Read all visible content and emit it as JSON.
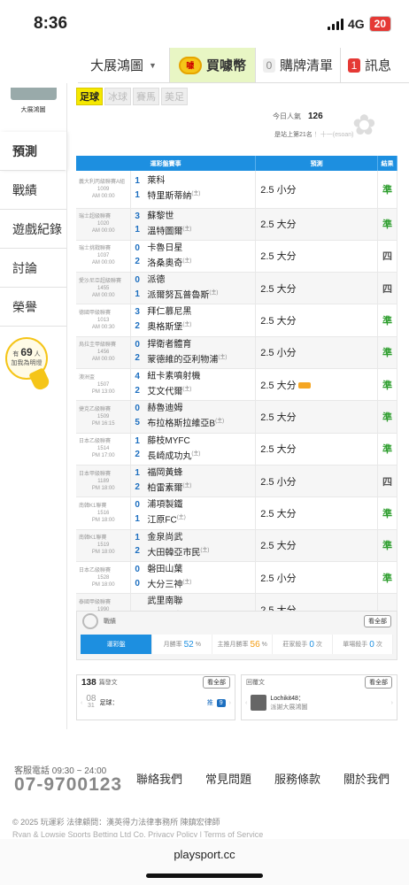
{
  "status": {
    "time": "8:36",
    "network": "4G",
    "battery": "20"
  },
  "nav": {
    "dropdown": "大展鴻圖",
    "coin_label": "買噱幣",
    "coin_icon_text": "噱",
    "cart_count": "0",
    "cart_label": "購牌清單",
    "msg_count": "1",
    "msg_label": "訊息"
  },
  "sidebar": {
    "avatar_label": "大展鴻圖",
    "items": [
      "預測",
      "戰績",
      "遊戲紀錄",
      "討論",
      "榮譽"
    ]
  },
  "online": {
    "prefix": "有",
    "count": "69",
    "suffix": "人",
    "line2": "加我為明燈"
  },
  "sport_tabs": [
    "足球",
    "冰球",
    "賽馬",
    "美足"
  ],
  "stats": {
    "pop_label": "今日人氣",
    "pop_value": "126",
    "rank_text": "是站上第21名",
    "rank_extra": "！十一(esoan)"
  },
  "table": {
    "headers": [
      "運彩盤賽事",
      "預測",
      "結果"
    ],
    "rows": [
      {
        "league": "義大利丙級聯賽A組",
        "no": "1009",
        "time": "AM 00:00",
        "s1": "1",
        "t1": "萊科",
        "s2": "1",
        "t2": "特里斯蒂納",
        "m2": "(主)",
        "pred": "2.5 小分",
        "res": "準",
        "rt": "win"
      },
      {
        "league": "瑞士超級聯賽",
        "no": "1020",
        "time": "AM 00:00",
        "s1": "3",
        "t1": "蘇黎世",
        "s2": "1",
        "t2": "溫特圖爾",
        "m2": "(主)",
        "pred": "2.5 大分",
        "res": "準",
        "rt": "win"
      },
      {
        "league": "瑞士挑戰聯賽",
        "no": "1037",
        "time": "AM 00:00",
        "s1": "0",
        "t1": "卡魯日星",
        "s2": "2",
        "t2": "洛桑奧奇",
        "m2": "(主)",
        "pred": "2.5 大分",
        "res": "四",
        "rt": "lose"
      },
      {
        "league": "愛沙尼亞超級聯賽",
        "no": "1455",
        "time": "AM 00:00",
        "s1": "0",
        "t1": "派德",
        "s2": "1",
        "t2": "派爾努瓦普魯斯",
        "m2": "(主)",
        "pred": "2.5 大分",
        "res": "四",
        "rt": "lose"
      },
      {
        "league": "德國甲級聯賽",
        "no": "1013",
        "time": "AM 00:30",
        "s1": "3",
        "t1": "拜仁慕尼黑",
        "s2": "2",
        "t2": "奧格斯堡",
        "m2": "(主)",
        "pred": "2.5 大分",
        "res": "準",
        "rt": "win"
      },
      {
        "league": "烏拉圭甲級聯賽",
        "no": "1456",
        "time": "AM 00:00",
        "s1": "0",
        "t1": "捍衛者體育",
        "s2": "2",
        "t2": "蒙德維的亞利物浦",
        "m2": "(主)",
        "pred": "2.5 小分",
        "res": "準",
        "rt": "win"
      },
      {
        "league": "澳洲盃",
        "no": "1507",
        "time": "PM 13:00",
        "s1": "4",
        "t1": "紐卡素噴射機",
        "s2": "2",
        "t2": "艾文代爾",
        "m2": "(主)",
        "pred": "2.5 大分",
        "hot": true,
        "res": "準",
        "rt": "win"
      },
      {
        "league": "捷克乙級聯賽",
        "no": "1509",
        "time": "PM 16:15",
        "s1": "0",
        "t1": "赫魯迪姆",
        "s2": "5",
        "t2": "布拉格斯拉維亞B",
        "m2": "(主)",
        "pred": "2.5 大分",
        "res": "準",
        "rt": "win"
      },
      {
        "league": "日本乙級聯賽",
        "no": "1514",
        "time": "PM 17:00",
        "s1": "1",
        "t1": "藤枝MYFC",
        "s2": "2",
        "t2": "長崎成功丸",
        "m2": "(主)",
        "pred": "2.5 大分",
        "res": "準",
        "rt": "win"
      },
      {
        "league": "日本甲級聯賽",
        "no": "1189",
        "time": "PM 18:00",
        "s1": "1",
        "t1": "福岡黃蜂",
        "s2": "2",
        "t2": "柏雷素爾",
        "m2": "(主)",
        "pred": "2.5 小分",
        "res": "四",
        "rt": "lose"
      },
      {
        "league": "南韓K1聯賽",
        "no": "1516",
        "time": "PM 18:00",
        "s1": "0",
        "t1": "浦項製鐵",
        "s2": "1",
        "t2": "江原FC",
        "m2": "(主)",
        "pred": "2.5 大分",
        "res": "準",
        "rt": "win"
      },
      {
        "league": "南韓K1聯賽",
        "no": "1519",
        "time": "PM 18:00",
        "s1": "1",
        "t1": "金泉尚武",
        "s2": "2",
        "t2": "大田韓亞市民",
        "m2": "(主)",
        "pred": "2.5 大分",
        "res": "準",
        "rt": "win"
      },
      {
        "league": "日本乙級聯賽",
        "no": "1528",
        "time": "PM 18:00",
        "s1": "0",
        "t1": "磐田山葉",
        "s2": "0",
        "t2": "大分三神",
        "m2": "(主)",
        "pred": "2.5 小分",
        "res": "準",
        "rt": "win"
      },
      {
        "league": "泰國甲級聯賽",
        "no": "1990",
        "time": "PM 18:00",
        "s1": "",
        "t1": "武里南聯",
        "s2": "",
        "t2": "清萊聯",
        "m2": "(主)",
        "pred": "2.5 大分",
        "res": "",
        "rt": "none"
      }
    ]
  },
  "record": {
    "label": "戰績",
    "view_all": "看全部",
    "cells": [
      {
        "label": "運彩盤",
        "value": ""
      },
      {
        "label": "月勝率",
        "value": "52",
        "unit": "%"
      },
      {
        "label": "主推月勝率",
        "value": "56",
        "unit": "%"
      },
      {
        "label": "莊家殺手",
        "value": "0",
        "unit": "次"
      },
      {
        "label": "單場殺手",
        "value": "0",
        "unit": "次"
      }
    ]
  },
  "posts": {
    "count": "138",
    "label": "篇發文",
    "view_all": "看全部",
    "day": "08",
    "month": "31",
    "title": "足球：",
    "reply_prefix": "推",
    "reply": "9"
  },
  "replies": {
    "label": "回覆文",
    "view_all": "看全部",
    "user": "Lochikit48：",
    "text": "派謝大展鴻圖"
  },
  "footer": {
    "svc": "客服電話 09:30 ~ 24:00",
    "phone": "07-9700123",
    "links": [
      "聯絡我們",
      "常見問題",
      "服務條款",
      "關於我們"
    ],
    "copy": "© 2025 玩運彩 法律顧問：漢英得力法律事務所 陳鎮宏律師",
    "cut": "Ryan & Lowsie Sports Betting Ltd Co.  Privacy Policy  |  Terms of Service"
  },
  "url": "playsport.cc",
  "colors": {
    "accent": "#1d8fe0",
    "win": "#2e9e2e",
    "coin_bg": "#e8f6c4",
    "sport_active": "#f5e800"
  }
}
